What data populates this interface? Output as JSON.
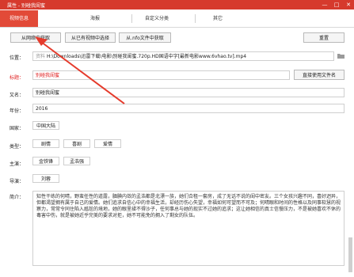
{
  "window": {
    "title": "属性 - 别碰我闺蜜",
    "min_glyph": "—",
    "max_glyph": "□",
    "close_glyph": "✕"
  },
  "tabs": [
    {
      "label": "视频信息",
      "active": true
    },
    {
      "label": "海报"
    },
    {
      "label": "自定义分类"
    },
    {
      "label": "其它"
    }
  ],
  "toolbar": {
    "fetch_web": "从网络中获取",
    "choose_existing": "从已有视频中选择",
    "fetch_nfo": "从.nfo文件中获取",
    "reset": "重置"
  },
  "form": {
    "location_label": "位置：",
    "location_prefix": "资料",
    "location_value": "H:\\Downloads\\迅雷下载\\电影\\别碰我闺蜜.720p.HD国语中字[最新电影www.6vhao.tv].mp4",
    "title_label": "标题：",
    "title_value": "别碰我闺蜜",
    "use_filename_button": "直接使用文件名",
    "alias_label": "又名：",
    "alias_value": "别碰我闺蜜",
    "year_label": "年份：",
    "year_value": "2016",
    "country_label": "国家：",
    "country_value": "中国大陆",
    "genre_label": "类型：",
    "genres": [
      "剧情",
      "喜剧",
      "爱情"
    ],
    "cast_label": "主演：",
    "cast": [
      "金铁锋",
      "孟浩强"
    ],
    "director_label": "导演：",
    "director": "刘蓉",
    "summary_label": "简介：",
    "summary": "知性干练的何晴，野蛮任性的道露，腼腆内敛的孟浩都是北漂一族，她们合租一套房，成了无话不说的闺中密友。三个女孩兴趣不同，喜好迥异，但都渴望拥有属于自己的爱情。她们追求自信心中的幸福生活，却经历伤心失望，幸福如何可望而不可及；何晴眼和时间的性格以及同事软慧的视察力，常常令同住陷入尴尬的境地，她的眼里揉不得沙子，任何事总与她的现实不过她的追求；这让她相信的真士信慢压力，不是被她喜欢不休的毒害中伤，就是被她近乎完美的要求对拒，她不可能免的拥入了剩女的队伍。"
  }
}
